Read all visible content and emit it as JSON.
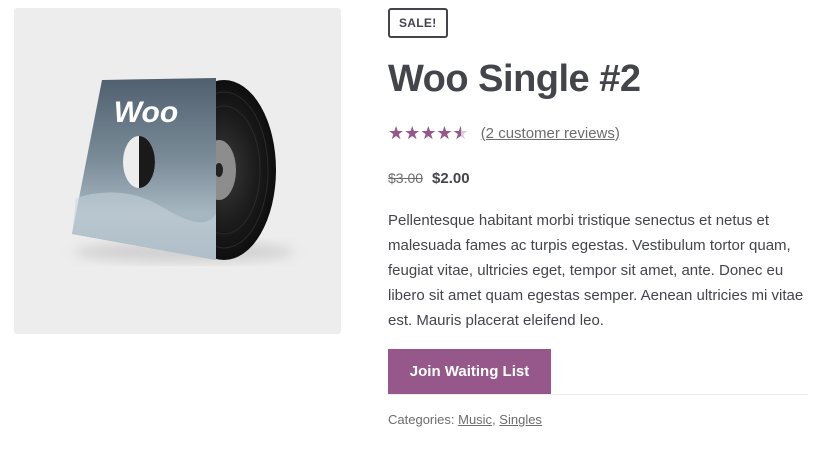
{
  "gallery": {
    "image_alt": "vinyl record in sleeve",
    "sleeve_text": "Woo"
  },
  "product": {
    "sale_badge": "SALE!",
    "title": "Woo Single #2",
    "rating": 4.5,
    "rating_max": 5,
    "reviews_link": "(2 customer reviews)",
    "regular_price": "$3.00",
    "sale_price": "$2.00",
    "description": "Pellentesque habitant morbi tristique senectus et netus et malesuada fames ac turpis egestas. Vestibulum tortor quam, feugiat vitae, ultricies eget, tempor sit amet, ante. Donec eu libero sit amet quam egestas semper. Aenean ultricies mi vitae est. Mauris placerat eleifend leo.",
    "button_label": "Join Waiting List",
    "categories_label": "Categories:",
    "categories": [
      "Music",
      "Singles"
    ],
    "category_separator": ", "
  },
  "colors": {
    "accent": "#96588a",
    "text": "#43454b",
    "muted": "#6d6d6d",
    "gallery_bg": "#ededed"
  }
}
